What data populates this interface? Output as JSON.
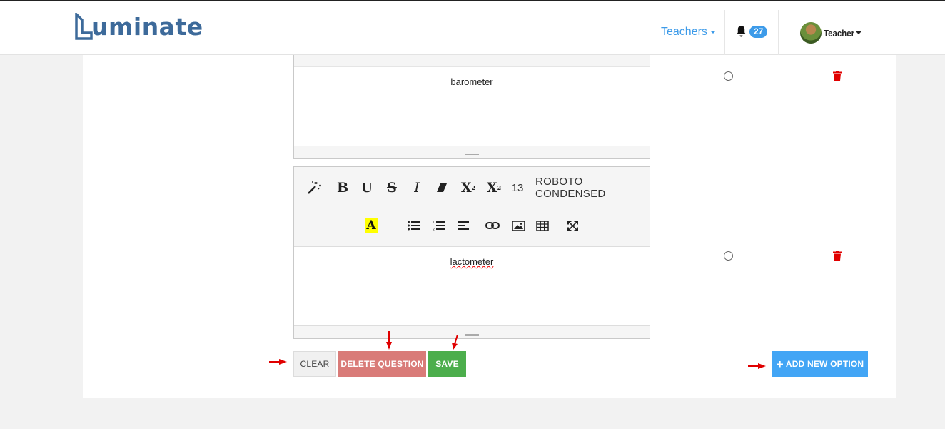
{
  "brand": {
    "name": "uminate",
    "logo_letter": "L"
  },
  "nav": {
    "teachers_label": "Teachers",
    "notifications_count": "27",
    "user_name": "Teacher"
  },
  "editor1": {
    "text": "barometer"
  },
  "editor2": {
    "text": "lactometer",
    "toolbar": {
      "font_size": "13",
      "font_name": "ROBOTO CONDENSED",
      "buttons": [
        "magic-wand",
        "bold",
        "underline",
        "strikethrough",
        "italic",
        "eraser",
        "superscript",
        "subscript",
        "font-size",
        "font-family",
        "highlight-color",
        "unordered-list",
        "ordered-list",
        "align",
        "link",
        "picture",
        "table",
        "fullscreen"
      ]
    }
  },
  "buttons": {
    "clear": "CLEAR",
    "delete_question": "DELETE QUESTION",
    "save": "SAVE",
    "add_new_option": "ADD NEW OPTION"
  },
  "colors": {
    "brand": "#3d6a9a",
    "accent": "#3d9be9",
    "delete": "#d97b78",
    "save": "#4cae4c",
    "add": "#42a5f5",
    "trash": "#e00000",
    "annotation_arrow": "#e00000"
  }
}
